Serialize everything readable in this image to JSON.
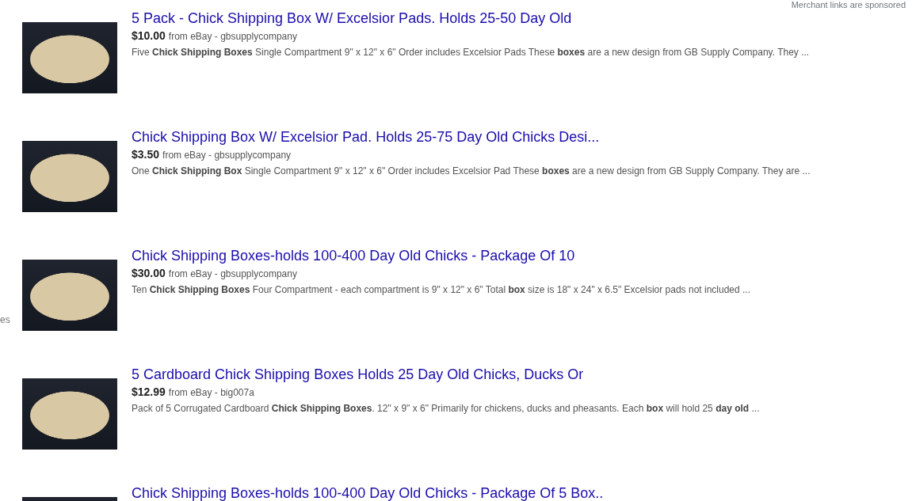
{
  "sponsored_note": "Merchant links are sponsored",
  "left_fragment": "es",
  "results": [
    {
      "title": "5 Pack - Chick Shipping Box W/ Excelsior Pads. Holds 25-50 Day Old",
      "price": "$10.00",
      "source": "from eBay - gbsupplycompany",
      "description": "Five **Chick Shipping Boxes** Single Compartment 9\" x 12\" x 6\" Order includes Excelsior Pads These **boxes** are a new design from GB Supply Company. They ..."
    },
    {
      "title": "Chick Shipping Box W/ Excelsior Pad. Holds 25-75 Day Old Chicks Desi...",
      "price": "$3.50",
      "source": "from eBay - gbsupplycompany",
      "description": "One **Chick Shipping Box** Single Compartment 9\" x 12\" x 6\" Order includes Excelsior Pad These **boxes** are a new design from GB Supply Company. They are ..."
    },
    {
      "title": "Chick Shipping Boxes-holds 100-400 Day Old Chicks - Package Of 10",
      "price": "$30.00",
      "source": "from eBay - gbsupplycompany",
      "description": "Ten **Chick Shipping Boxes** Four Compartment - each compartment is 9\" x 12\" x 6\" Total **box** size is 18\" x 24\" x 6.5\" Excelsior pads not included ..."
    },
    {
      "title": "5 Cardboard Chick Shipping Boxes Holds 25 Day Old Chicks, Ducks Or",
      "price": "$12.99",
      "source": "from eBay - big007a",
      "description": "Pack of 5 Corrugated Cardboard **Chick Shipping Boxes**. 12\" x 9\" x 6\" Primarily for chickens, ducks and pheasants. Each **box** will hold 25 **day old** ..."
    },
    {
      "title": "Chick Shipping Boxes-holds 100-400 Day Old Chicks - Package Of 5 Box.."
    }
  ]
}
